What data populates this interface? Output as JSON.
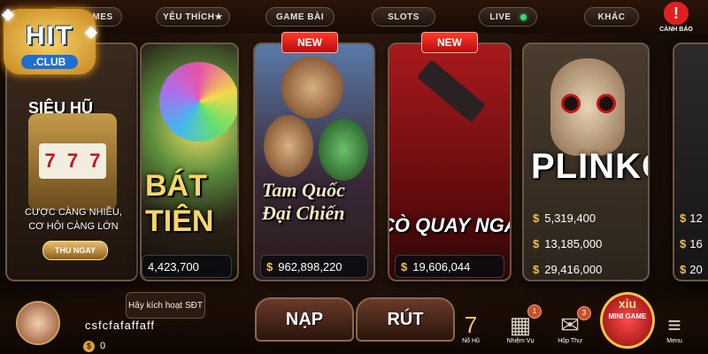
{
  "nav": {
    "all_games": "ALL GAMES",
    "favorites": "YÊU THÍCH★",
    "game_bai": "GAME BÀI",
    "slots": "SLOTS",
    "live": "LIVE",
    "khac": "KHÁC",
    "warning_label": "CẢNH BÁO",
    "warning_icon": "warning-icon"
  },
  "logo": {
    "hit": "HIT",
    "club": ".CLUB"
  },
  "promo": {
    "title": "SIÊU HŨ",
    "reels": [
      "7",
      "7",
      "7"
    ],
    "line1": "CƯỢC CÀNG NHIỀU,",
    "line2": "CƠ HỘI CÀNG LỚN",
    "button": "THU NGAY"
  },
  "games": [
    {
      "title": "BÁT\nTIÊN",
      "jackpot": "4,423,700",
      "new": false
    },
    {
      "title": "Tam Quốc\nĐại Chiến",
      "jackpot": "962,898,220",
      "new": true,
      "badge": "NEW"
    },
    {
      "title": "CÒ QUAY NGA",
      "jackpot": "19,606,044",
      "new": true,
      "badge": "NEW"
    },
    {
      "title": "PLINKO",
      "jackpots": [
        "5,319,400",
        "13,185,000",
        "29,416,000"
      ],
      "new": false
    },
    {
      "jackpots": [
        "12",
        "16",
        "20"
      ]
    }
  ],
  "currency_symbol": "$",
  "user": {
    "activate": "Hãy kích hoạt SĐT",
    "username": "csfcfafaffaff",
    "balance": "0",
    "coin_symbol": "$"
  },
  "actions": {
    "nap": "NẠP",
    "rut": "RÚT"
  },
  "bottom_icons": [
    {
      "name": "jackpot",
      "label": "Nổ Hũ",
      "badge": ""
    },
    {
      "name": "gift",
      "label": "Nhiệm Vụ",
      "badge": "1"
    },
    {
      "name": "mail",
      "label": "Hộp Thư",
      "badge": "3"
    }
  ],
  "minigame": {
    "xiu": "xỉu",
    "label": "MINI GAME"
  },
  "menu": {
    "label": "Menu"
  },
  "colors": {
    "accent_gold": "#f2c14a",
    "badge_red": "#e02020",
    "live_green": "#33e06a"
  }
}
